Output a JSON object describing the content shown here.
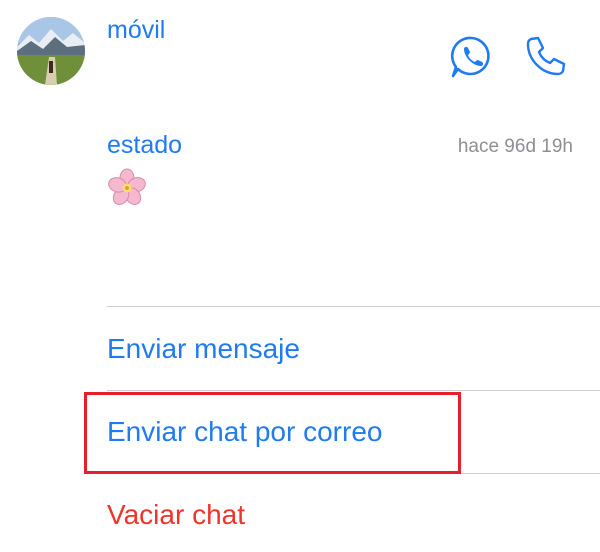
{
  "contact": {
    "phone_label": "móvil",
    "avatar_icon": "mountain-landscape-avatar"
  },
  "actions": {
    "whatsapp_icon": "whatsapp-icon",
    "call_icon": "phone-icon",
    "accent_color": "#1f7cf0"
  },
  "status": {
    "label": "estado",
    "time": "hace 96d 19h",
    "emoji_icon": "cherry-blossom-icon"
  },
  "menu": {
    "items": [
      {
        "label": "Enviar mensaje"
      },
      {
        "label": "Enviar chat por correo",
        "highlighted": true
      },
      {
        "label": "Vaciar chat",
        "destructive": true,
        "color": "#f0342a"
      }
    ],
    "highlight_color": "#e5202a"
  }
}
